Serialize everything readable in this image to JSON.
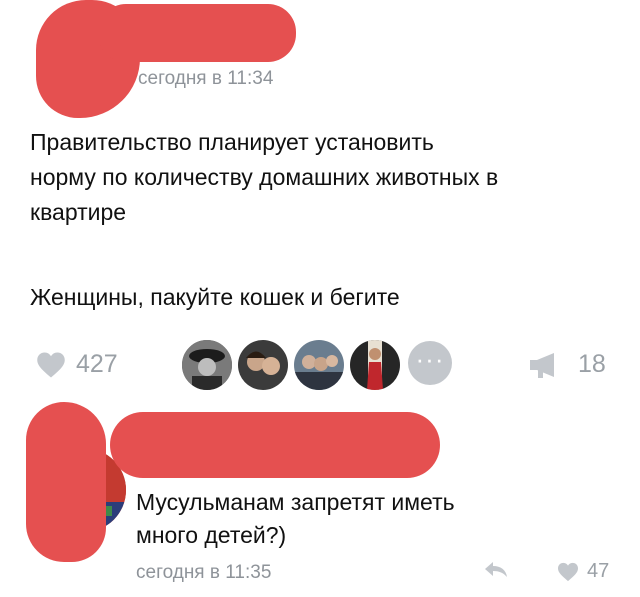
{
  "post": {
    "time": "сегодня в 11:34",
    "text_lines": [
      "Правительство планирует установить",
      "норму по количеству домашних животных в",
      "квартире",
      "Женщины, пакуйте кошек и бегите"
    ],
    "likes": "427",
    "shares": "18",
    "more_label": "···"
  },
  "comment": {
    "text_lines": [
      "Мусульманам запретят иметь",
      "много детей?)"
    ],
    "time": "сегодня в 11:35",
    "likes": "47"
  },
  "colors": {
    "redaction": "#e55050",
    "muted": "#9aa0a6",
    "text": "#111111"
  }
}
